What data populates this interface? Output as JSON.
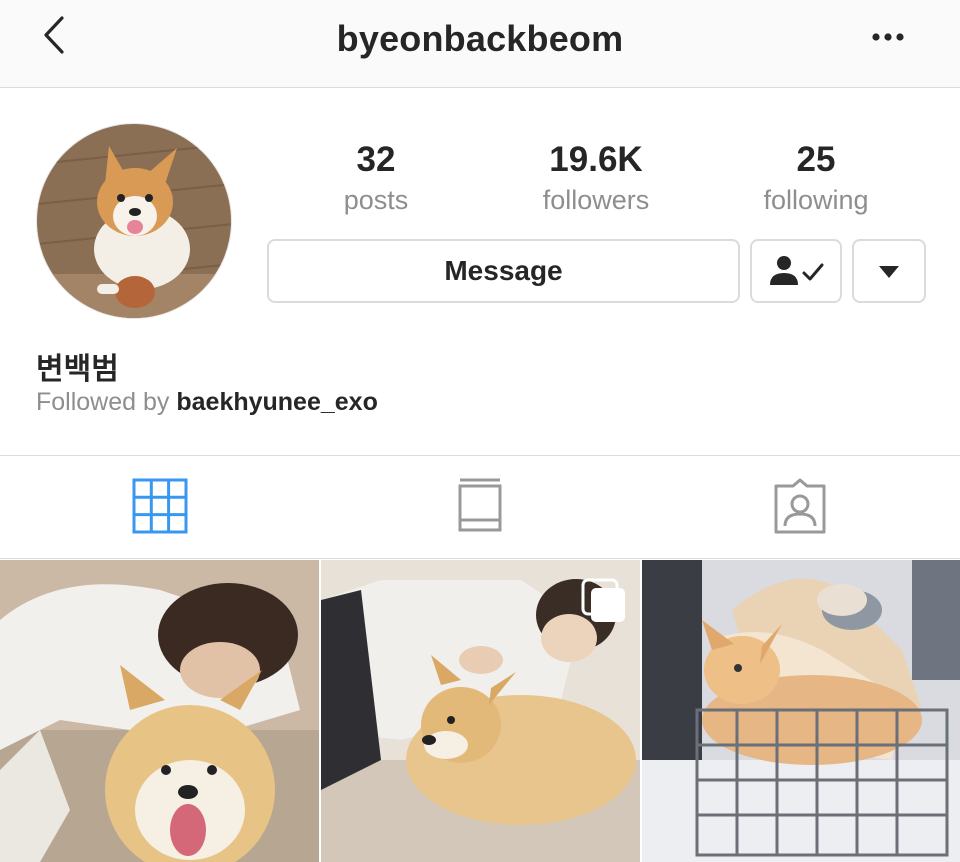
{
  "header": {
    "username": "byeonbackbeom",
    "back_icon": "chevron-left-icon",
    "more_icon": "more-horizontal-icon"
  },
  "profile": {
    "avatar_icon": "avatar-corgi",
    "stats": [
      {
        "value": "32",
        "label": "posts"
      },
      {
        "value": "19.6K",
        "label": "followers"
      },
      {
        "value": "25",
        "label": "following"
      }
    ],
    "message_label": "Message",
    "following_icon": "person-check-icon",
    "dropdown_icon": "caret-down-icon",
    "full_name": "변백범",
    "followed_by_prefix": "Followed by",
    "followed_by_user": "baekhyunee_exo"
  },
  "tabs": [
    {
      "name": "grid",
      "icon": "grid-icon",
      "active": true
    },
    {
      "name": "feed",
      "icon": "feed-icon",
      "active": false
    },
    {
      "name": "tagged",
      "icon": "tagged-icon",
      "active": false
    }
  ],
  "colors": {
    "active_tab": "#3897f0",
    "inactive_tab": "#999999",
    "text_primary": "#262626",
    "text_secondary": "#8e8e8e",
    "border": "#dbdbdb"
  },
  "posts": [
    {
      "type": "photo"
    },
    {
      "type": "carousel",
      "badge_icon": "multiple-images-icon"
    },
    {
      "type": "photo"
    }
  ]
}
